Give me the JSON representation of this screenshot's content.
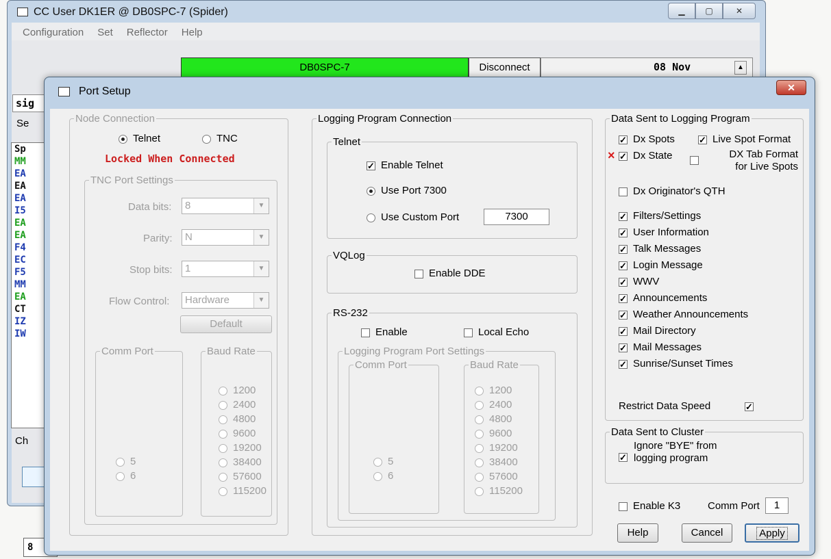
{
  "shell": {
    "title": "CC User DK1ER @ DB0SPC-7  (Spider)",
    "menu": [
      "Configuration",
      "Set",
      "Reflector",
      "Help"
    ],
    "node_label": "DB0SPC-7",
    "disconnect": "Disconnect",
    "date": "08 Nov",
    "left_list": [
      {
        "text": "MM",
        "color": "#1e9e1e"
      },
      {
        "text": "EA",
        "color": "#1f3cb0"
      },
      {
        "text": "EA",
        "color": "#111111"
      },
      {
        "text": "EA",
        "color": "#1f3cb0"
      },
      {
        "text": "I5",
        "color": "#1f3cb0"
      },
      {
        "text": "EA",
        "color": "#1e9e1e"
      },
      {
        "text": "EA",
        "color": "#1e9e1e"
      },
      {
        "text": "F4",
        "color": "#1f3cb0"
      },
      {
        "text": "EC",
        "color": "#1f3cb0"
      },
      {
        "text": "F5",
        "color": "#1f3cb0"
      },
      {
        "text": "MM",
        "color": "#1f3cb0"
      },
      {
        "text": "EA",
        "color": "#1e9e1e"
      },
      {
        "text": "CT",
        "color": "#111111"
      },
      {
        "text": "IZ",
        "color": "#1f3cb0"
      },
      {
        "text": "IW",
        "color": "#1f3cb0"
      }
    ],
    "fragments": {
      "sig": "sig",
      "se": "Se",
      "sp": "Sp",
      "ch": "Ch",
      "bottom": "8"
    }
  },
  "dialog": {
    "title": "Port Setup",
    "node_connection": {
      "legend": "Node Connection",
      "telnet": "Telnet",
      "tnc": "TNC",
      "locked": "Locked When Connected",
      "tnc_settings": {
        "legend": "TNC Port Settings",
        "data_bits_label": "Data bits:",
        "data_bits": "8",
        "parity_label": "Parity:",
        "parity": "N",
        "stop_bits_label": "Stop bits:",
        "stop_bits": "1",
        "flow_label": "Flow Control:",
        "flow": "Hardware",
        "default_btn": "Default"
      },
      "comm_port": {
        "legend": "Comm Port",
        "options": [
          "5",
          "6"
        ]
      },
      "baud_rate": {
        "legend": "Baud Rate",
        "options": [
          "1200",
          "2400",
          "4800",
          "9600",
          "19200",
          "38400",
          "57600",
          "115200"
        ]
      }
    },
    "logging_connection": {
      "legend": "Logging Program Connection",
      "telnet": {
        "legend": "Telnet",
        "enable": "Enable Telnet",
        "use_port": "Use Port 7300",
        "custom_port": "Use Custom Port",
        "custom_value": "7300"
      },
      "vqlog": {
        "legend": "VQLog",
        "enable_dde": "Enable DDE"
      },
      "rs232": {
        "legend": "RS-232",
        "enable": "Enable",
        "local_echo": "Local Echo",
        "port_settings": "Logging Program Port Settings",
        "comm_port": {
          "legend": "Comm Port",
          "options": [
            "5",
            "6"
          ]
        },
        "baud_rate": {
          "legend": "Baud Rate",
          "options": [
            "1200",
            "2400",
            "4800",
            "9600",
            "19200",
            "38400",
            "57600",
            "115200"
          ]
        }
      }
    },
    "data_sent": {
      "legend": "Data Sent to Logging Program",
      "dx_spots": "Dx Spots",
      "live_spot": "Live Spot Format",
      "dx_state": "Dx State",
      "dx_tab_1": "DX Tab Format",
      "dx_tab_2": "for Live Spots",
      "originator": "Dx Originator's QTH",
      "items": [
        "Filters/Settings",
        "User Information",
        "Talk Messages",
        "Login Message",
        "WWV",
        "Announcements",
        "Weather Announcements",
        "Mail Directory",
        "Mail Messages",
        "Sunrise/Sunset Times"
      ],
      "restrict": "Restrict Data Speed",
      "x_mark": "×"
    },
    "cluster": {
      "legend": "Data Sent to Cluster",
      "ignore_1": "Ignore \"BYE\" from",
      "ignore_2": "logging program"
    },
    "k3": {
      "enable": "Enable K3",
      "comm_label": "Comm Port",
      "comm_value": "1"
    },
    "buttons": {
      "help": "Help",
      "cancel": "Cancel",
      "apply": "Apply"
    },
    "check_mark": "✓"
  }
}
